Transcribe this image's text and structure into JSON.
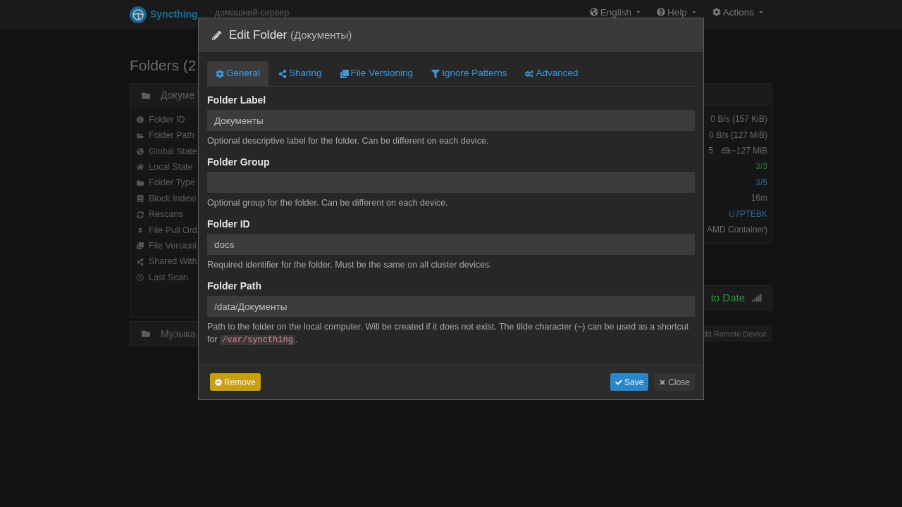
{
  "navbar": {
    "brand": "Syncthing",
    "device_name": "домашний-сервер",
    "menus": [
      {
        "label": "English"
      },
      {
        "label": "Help"
      },
      {
        "label": "Actions"
      }
    ]
  },
  "folders": {
    "heading": "Folders (2",
    "panels": [
      {
        "name": "Докуме",
        "expanded": true,
        "rows": [
          "Folder ID",
          "Folder Path",
          "Global State",
          "Local State",
          "Folder Type",
          "Block Indexi",
          "Rescans",
          "File Pull Ord",
          "File Versioni",
          "Shared With",
          "Last Scan"
        ]
      },
      {
        "name": "Музыка",
        "expanded": false
      }
    ]
  },
  "this_device": {
    "rows": [
      {
        "kind": "plain",
        "value": "0 B/s (157 KiB)"
      },
      {
        "kind": "plain",
        "value": "0 B/s (127 MiB)"
      },
      {
        "kind": "totals",
        "count": "5",
        "value": "~127 MiB"
      },
      {
        "kind": "success",
        "value": "3/3"
      },
      {
        "kind": "info",
        "value": "3/5"
      },
      {
        "kind": "plain",
        "value": "16m"
      },
      {
        "kind": "info",
        "value": "U7PTEBK"
      },
      {
        "kind": "plain",
        "value": "AMD Container)"
      }
    ]
  },
  "remote_device": {
    "status": "to Date"
  },
  "add_device_button": {
    "label": "dd Remote Device"
  },
  "modal": {
    "title": "Edit Folder",
    "subtitle": "(Документы)",
    "tabs": [
      {
        "label": "General",
        "selected": true
      },
      {
        "label": "Sharing",
        "selected": false
      },
      {
        "label": "File Versioning",
        "selected": false
      },
      {
        "label": "Ignore Patterns",
        "selected": false
      },
      {
        "label": "Advanced",
        "selected": false
      }
    ],
    "fields": [
      {
        "label": "Folder Label",
        "value": "Документы",
        "help": "Optional descriptive label for the folder. Can be different on each device."
      },
      {
        "label": "Folder Group",
        "help": "Optional group for the folder. Can be different on each device."
      },
      {
        "label": "Folder ID",
        "value": "docs",
        "help": "Required identifier for the folder. Must be the same on all cluster devices."
      },
      {
        "label": "Folder Path",
        "value": "/data/Документы",
        "help": "Path to the folder on the local computer. Will be created if it does not exist. The tilde character (~) can be used as a shortcut for",
        "help_code": "/var/syncthing",
        "help_suffix": "."
      }
    ],
    "buttons": [
      {
        "label": "Remove",
        "kind": "warning"
      },
      {
        "label": "Save",
        "kind": "primary"
      },
      {
        "label": "Close",
        "kind": "default"
      }
    ]
  }
}
